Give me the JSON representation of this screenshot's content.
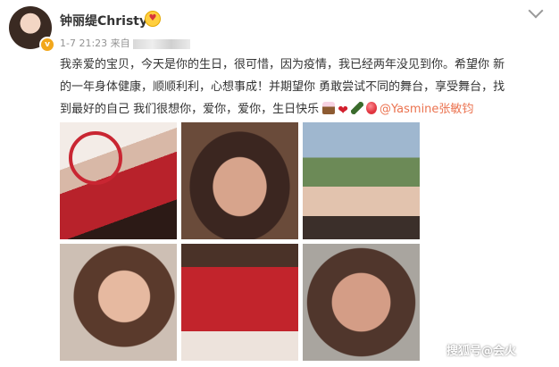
{
  "header": {
    "username": "钟丽缇Christy",
    "verified_badge": "v",
    "meta_time": "1-7 21:23",
    "meta_source_prefix": "来自"
  },
  "post": {
    "lines": [
      "我亲爱的宝贝，今天是你的生日，很可惜，因为疫情，我已经两年没见到你。希望你 新",
      "的一年身体健康，顺顺利利，心想事成！并期望你 勇敢尝试不同的舞台，享受舞台，找",
      "到最好的自己 我们很想你，爱你，爱你，生日快乐"
    ],
    "mention_prefix": "@",
    "mention": "Yasmine张敏钧",
    "emojis": [
      "cake",
      "heart",
      "bottle",
      "balloon"
    ]
  },
  "photos": [
    {
      "id": 1
    },
    {
      "id": 2
    },
    {
      "id": 3
    },
    {
      "id": 4
    },
    {
      "id": 5
    },
    {
      "id": 6
    }
  ],
  "watermark": "搜狐号@会火",
  "colors": {
    "mention": "#eb7350",
    "meta": "#939393",
    "text": "#333333",
    "badge": "#f2a71b"
  }
}
